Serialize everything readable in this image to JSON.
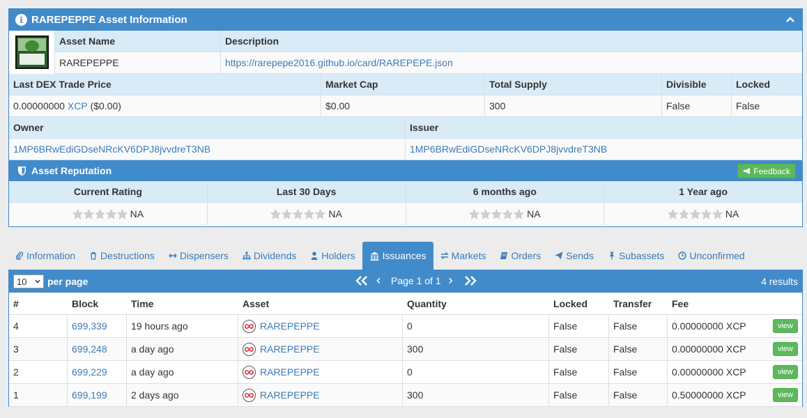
{
  "asset_panel": {
    "title": "RAREPEPPE Asset Information",
    "headers": {
      "asset_name": "Asset Name",
      "description": "Description"
    },
    "asset_name": "RAREPEPPE",
    "description_url": "https://rarepepe2016.github.io/card/RAREPEPE.json",
    "stats_headers": {
      "last_dex": "Last DEX Trade Price",
      "market_cap": "Market Cap",
      "total_supply": "Total Supply",
      "divisible": "Divisible",
      "locked": "Locked"
    },
    "last_dex_value": "0.00000000",
    "last_dex_unit": "XCP",
    "last_dex_usd": "($0.00)",
    "market_cap": "$0.00",
    "total_supply": "300",
    "divisible": "False",
    "locked": "False",
    "owner_header": "Owner",
    "issuer_header": "Issuer",
    "owner": "1MP6BRwEdiGDseNRcKV6DPJ8jvvdreT3NB",
    "issuer": "1MP6BRwEdiGDseNRcKV6DPJ8jvvdreT3NB"
  },
  "reputation": {
    "title": "Asset Reputation",
    "feedback_label": "Feedback",
    "columns": [
      {
        "header": "Current Rating",
        "value": "NA"
      },
      {
        "header": "Last 30 Days",
        "value": "NA"
      },
      {
        "header": "6 months ago",
        "value": "NA"
      },
      {
        "header": "1 Year ago",
        "value": "NA"
      }
    ]
  },
  "tabs": [
    {
      "label": "Information",
      "icon": "paperclip-icon"
    },
    {
      "label": "Destructions",
      "icon": "trash-icon"
    },
    {
      "label": "Dispensers",
      "icon": "arrows-h-icon"
    },
    {
      "label": "Dividends",
      "icon": "sitemap-icon"
    },
    {
      "label": "Holders",
      "icon": "user-icon"
    },
    {
      "label": "Issuances",
      "icon": "bank-icon",
      "active": true
    },
    {
      "label": "Markets",
      "icon": "exchange-icon"
    },
    {
      "label": "Orders",
      "icon": "book-icon"
    },
    {
      "label": "Sends",
      "icon": "paper-plane-icon"
    },
    {
      "label": "Subassets",
      "icon": "thumb-tack-icon"
    },
    {
      "label": "Unconfirmed",
      "icon": "clock-icon"
    }
  ],
  "issuances": {
    "per_page_value": "10",
    "per_page_label": "per page",
    "page_text": "Page 1 of 1",
    "results_text": "4 results",
    "columns": [
      "#",
      "Block",
      "Time",
      "Asset",
      "Quantity",
      "Locked",
      "Transfer",
      "Fee"
    ],
    "view_label": "view",
    "rows": [
      {
        "num": "4",
        "block": "699,339",
        "time": "19 hours ago",
        "asset": "RAREPEPPE",
        "quantity": "0",
        "locked": "False",
        "transfer": "False",
        "fee": "0.00000000 XCP"
      },
      {
        "num": "3",
        "block": "699,248",
        "time": "a day ago",
        "asset": "RAREPEPPE",
        "quantity": "300",
        "locked": "False",
        "transfer": "False",
        "fee": "0.00000000 XCP"
      },
      {
        "num": "2",
        "block": "699,229",
        "time": "a day ago",
        "asset": "RAREPEPPE",
        "quantity": "0",
        "locked": "False",
        "transfer": "False",
        "fee": "0.00000000 XCP"
      },
      {
        "num": "1",
        "block": "699,199",
        "time": "2 days ago",
        "asset": "RAREPEPPE",
        "quantity": "300",
        "locked": "False",
        "transfer": "False",
        "fee": "0.50000000 XCP"
      }
    ]
  },
  "colors": {
    "primary": "#428bca",
    "header_bg": "#d9ebf6",
    "link": "#3a7bb8",
    "success": "#5cb85c"
  }
}
